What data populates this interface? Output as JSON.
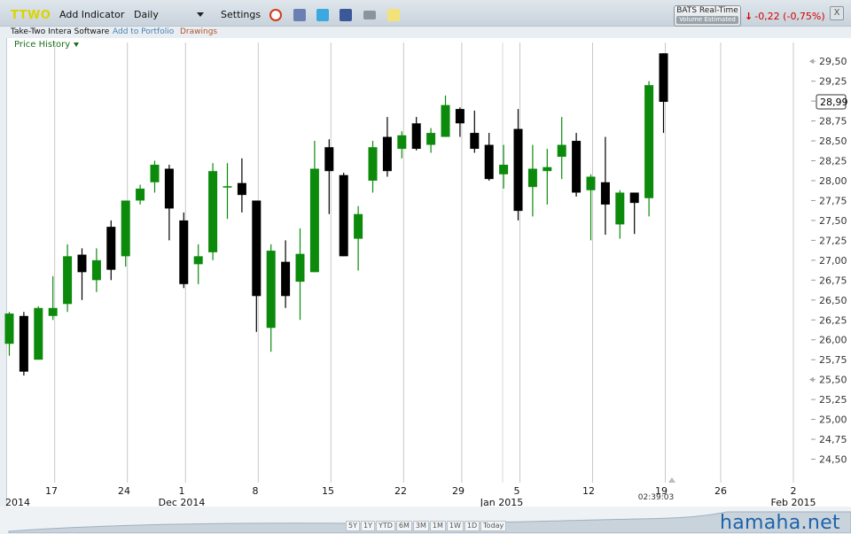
{
  "toolbar": {
    "ticker": "TTWO",
    "add_indicator": "Add Indicator",
    "interval": "Daily",
    "settings": "Settings",
    "icons": [
      "alarm-icon",
      "calendar-icon",
      "twitter-icon",
      "facebook-icon",
      "camera-icon",
      "note-icon"
    ],
    "bats_title": "BATS Real-Time",
    "bats_sub": "Volume Estimated",
    "change_text": "-0,22 (-0,75%)",
    "close": "X"
  },
  "subbar": {
    "company": "Take-Two Intera Software",
    "add_portfolio": "Add to Portfolio",
    "drawings": "Drawings"
  },
  "panel": {
    "title": "Price History"
  },
  "ranges": [
    "5Y",
    "1Y",
    "YTD",
    "6M",
    "3M",
    "1M",
    "1W",
    "1D",
    "Today"
  ],
  "watermark": "hamaha.net",
  "colors": {
    "up": "#0b8a0b",
    "down": "#000000",
    "change": "#d20000",
    "ticker": "#d9d400"
  },
  "chart_data": {
    "type": "candlestick",
    "ylim": [
      24.35,
      29.58
    ],
    "yticks": [
      "29,50",
      "29,25",
      "29,00",
      "28,75",
      "28,50",
      "28,25",
      "28,00",
      "27,75",
      "27,50",
      "27,25",
      "27,00",
      "26,75",
      "26,50",
      "26,25",
      "26,00",
      "25,75",
      "25,50",
      "25,25",
      "25,00",
      "24,75",
      "24,50"
    ],
    "last_price": "28,99",
    "time_label": "02:39:03",
    "xlabels_days": [
      "17",
      "24",
      "1",
      "8",
      "15",
      "22",
      "29",
      "5",
      "12",
      "19",
      "26",
      "2"
    ],
    "xlabels_months": [
      "2014",
      "Dec 2014",
      "Jan 2015",
      "Feb 2015"
    ],
    "candles": [
      {
        "o": 25.95,
        "h": 26.35,
        "l": 25.8,
        "c": 26.33
      },
      {
        "o": 26.3,
        "h": 26.35,
        "l": 25.55,
        "c": 25.6
      },
      {
        "o": 25.75,
        "h": 26.42,
        "l": 25.75,
        "c": 26.4
      },
      {
        "o": 26.3,
        "h": 26.8,
        "l": 26.25,
        "c": 26.4
      },
      {
        "o": 26.45,
        "h": 27.2,
        "l": 26.35,
        "c": 27.05
      },
      {
        "o": 27.07,
        "h": 27.15,
        "l": 26.5,
        "c": 26.85
      },
      {
        "o": 26.75,
        "h": 27.15,
        "l": 26.6,
        "c": 27.0
      },
      {
        "o": 27.42,
        "h": 27.5,
        "l": 26.75,
        "c": 26.88
      },
      {
        "o": 27.05,
        "h": 27.75,
        "l": 26.92,
        "c": 27.75
      },
      {
        "o": 27.75,
        "h": 27.95,
        "l": 27.7,
        "c": 27.9
      },
      {
        "o": 27.98,
        "h": 28.25,
        "l": 27.85,
        "c": 28.2
      },
      {
        "o": 28.15,
        "h": 28.2,
        "l": 27.25,
        "c": 27.65
      },
      {
        "o": 27.5,
        "h": 27.6,
        "l": 26.65,
        "c": 26.7
      },
      {
        "o": 26.95,
        "h": 27.2,
        "l": 26.7,
        "c": 27.05
      },
      {
        "o": 27.1,
        "h": 28.22,
        "l": 27.0,
        "c": 28.12
      },
      {
        "o": 27.92,
        "h": 28.22,
        "l": 27.52,
        "c": 27.93
      },
      {
        "o": 27.97,
        "h": 28.28,
        "l": 27.6,
        "c": 27.82
      },
      {
        "o": 27.75,
        "h": 27.75,
        "l": 26.1,
        "c": 26.55
      },
      {
        "o": 26.15,
        "h": 27.2,
        "l": 25.85,
        "c": 27.12
      },
      {
        "o": 26.98,
        "h": 27.25,
        "l": 26.4,
        "c": 26.55
      },
      {
        "o": 26.73,
        "h": 27.4,
        "l": 26.25,
        "c": 27.08
      },
      {
        "o": 26.85,
        "h": 28.5,
        "l": 26.85,
        "c": 28.15
      },
      {
        "o": 28.42,
        "h": 28.52,
        "l": 27.58,
        "c": 28.12
      },
      {
        "o": 28.07,
        "h": 28.1,
        "l": 27.05,
        "c": 27.05
      },
      {
        "o": 27.27,
        "h": 27.68,
        "l": 26.87,
        "c": 27.58
      },
      {
        "o": 28.0,
        "h": 28.5,
        "l": 27.85,
        "c": 28.42
      },
      {
        "o": 28.55,
        "h": 28.8,
        "l": 28.05,
        "c": 28.12
      },
      {
        "o": 28.4,
        "h": 28.62,
        "l": 28.28,
        "c": 28.57
      },
      {
        "o": 28.72,
        "h": 28.8,
        "l": 28.38,
        "c": 28.4
      },
      {
        "o": 28.45,
        "h": 28.66,
        "l": 28.35,
        "c": 28.6
      },
      {
        "o": 28.55,
        "h": 29.07,
        "l": 28.55,
        "c": 28.95
      },
      {
        "o": 28.9,
        "h": 28.92,
        "l": 28.55,
        "c": 28.72
      },
      {
        "o": 28.6,
        "h": 28.88,
        "l": 28.35,
        "c": 28.4
      },
      {
        "o": 28.45,
        "h": 28.6,
        "l": 28.0,
        "c": 28.02
      },
      {
        "o": 28.08,
        "h": 28.45,
        "l": 27.9,
        "c": 28.2
      },
      {
        "o": 28.65,
        "h": 28.9,
        "l": 27.5,
        "c": 27.62
      },
      {
        "o": 27.92,
        "h": 28.45,
        "l": 27.55,
        "c": 28.15
      },
      {
        "o": 28.12,
        "h": 28.4,
        "l": 27.7,
        "c": 28.17
      },
      {
        "o": 28.3,
        "h": 28.8,
        "l": 28.02,
        "c": 28.45
      },
      {
        "o": 28.5,
        "h": 28.6,
        "l": 27.8,
        "c": 27.85
      },
      {
        "o": 27.88,
        "h": 28.08,
        "l": 27.25,
        "c": 28.05
      },
      {
        "o": 27.98,
        "h": 28.55,
        "l": 27.32,
        "c": 27.7
      },
      {
        "o": 27.45,
        "h": 27.88,
        "l": 27.27,
        "c": 27.85
      },
      {
        "o": 27.85,
        "h": 27.85,
        "l": 27.33,
        "c": 27.72
      },
      {
        "o": 27.78,
        "h": 29.25,
        "l": 27.55,
        "c": 29.2
      },
      {
        "o": 29.6,
        "h": 29.6,
        "l": 28.6,
        "c": 28.99
      }
    ]
  }
}
